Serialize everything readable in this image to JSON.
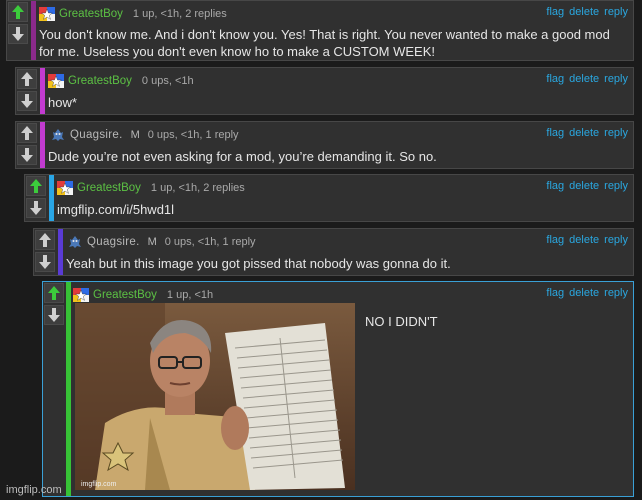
{
  "colors": {
    "upvote": "#3ccb3c",
    "downvote": "#cfcfcf",
    "green_user": "#5cc144",
    "action_link": "#2aa7e0",
    "thread_bars": [
      "#8b2a8b",
      "#c23bd0",
      "#c23bd0",
      "#29a6e6",
      "#5a3bd6",
      "#37c236"
    ]
  },
  "actions": {
    "flag": "flag",
    "delete": "delete",
    "reply": "reply"
  },
  "comments": [
    {
      "user": "GreatestBoy",
      "meta": "1 up, <1h, 2 replies",
      "text_line1": "You don't know me. And i don't know you. Yes! That is right. You never wanted to make a good mod",
      "text_line2": "for me. Useless you don't even know ho to make a CUSTOM WEEK!"
    },
    {
      "user": "GreatestBoy",
      "meta": "0 ups, <1h",
      "text": "how*"
    },
    {
      "user": "Quagsire.",
      "badge": "M",
      "meta": "0 ups, <1h, 1 reply",
      "text": "Dude you’re not even asking for a mod, you’re demanding it. So no."
    },
    {
      "user": "GreatestBoy",
      "meta": "1 up, <1h, 2 replies",
      "text": "imgflip.com/i/5hwd1l"
    },
    {
      "user": "Quagsire.",
      "badge": "M",
      "meta": "0 ups, <1h, 1 reply",
      "text": "Yeah but in this image you got pissed that nobody was gonna do it."
    },
    {
      "user": "GreatestBoy",
      "meta": "1 up, <1h",
      "text": "NO I DIDN'T",
      "image_caption": "imgflip.com"
    }
  ],
  "watermark": "imgflip.com"
}
